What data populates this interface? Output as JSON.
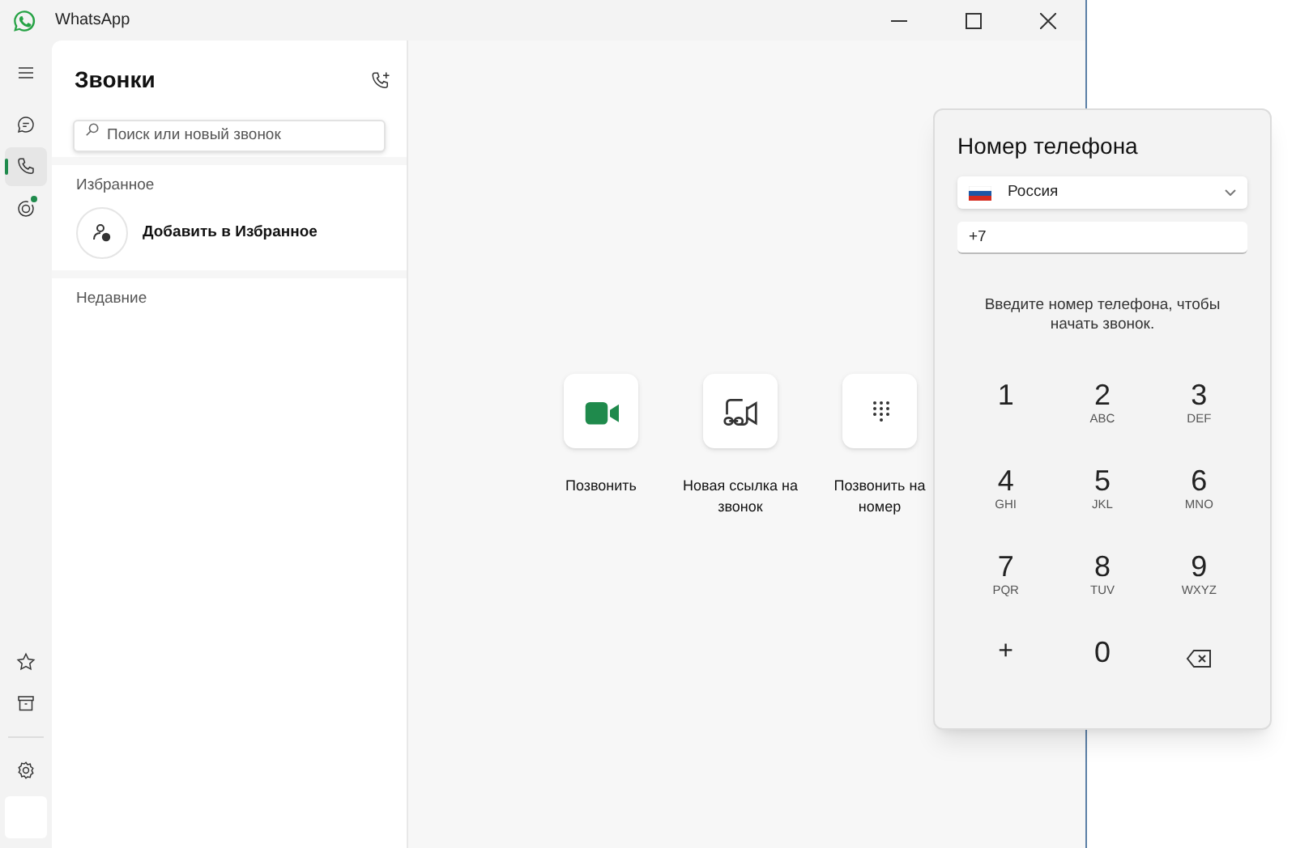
{
  "window": {
    "title": "WhatsApp"
  },
  "nav": {
    "top": [
      {
        "kind": "menu",
        "selected": false,
        "badge": false
      },
      {
        "kind": "chats",
        "selected": false,
        "badge": false
      },
      {
        "kind": "calls",
        "selected": true,
        "badge": false
      },
      {
        "kind": "status",
        "selected": false,
        "badge": true
      }
    ],
    "bottom": [
      {
        "kind": "starred",
        "selected": false,
        "badge": false
      },
      {
        "kind": "archive",
        "selected": false,
        "badge": false
      },
      {
        "kind": "settings",
        "selected": false,
        "badge": false
      }
    ]
  },
  "calls_panel": {
    "title": "Звонки",
    "search": {
      "placeholder": "Поиск или новый звонок"
    },
    "favorites": {
      "heading": "Избранное",
      "add_label": "Добавить в Избранное"
    },
    "recent": {
      "heading": "Недавние"
    }
  },
  "actions": [
    {
      "kind": "video",
      "label": "Позвонить"
    },
    {
      "kind": "link",
      "label": "Новая ссылка на звонок"
    },
    {
      "kind": "dialpad",
      "label": "Позвонить на номер"
    }
  ],
  "dialer": {
    "title": "Номер телефона",
    "country": "Россия",
    "number": "+7",
    "hint": "Введите номер телефона, чтобы начать звонок.",
    "keys": [
      {
        "kind": "digit",
        "digit": "1"
      },
      {
        "kind": "digit",
        "digit": "2",
        "letters": "ABC"
      },
      {
        "kind": "digit",
        "digit": "3",
        "letters": "DEF"
      },
      {
        "kind": "digit",
        "digit": "4",
        "letters": "GHI"
      },
      {
        "kind": "digit",
        "digit": "5",
        "letters": "JKL"
      },
      {
        "kind": "digit",
        "digit": "6",
        "letters": "MNO"
      },
      {
        "kind": "digit",
        "digit": "7",
        "letters": "PQR"
      },
      {
        "kind": "digit",
        "digit": "8",
        "letters": "TUV"
      },
      {
        "kind": "digit",
        "digit": "9",
        "letters": "WXYZ"
      },
      {
        "kind": "symbol",
        "digit": "+"
      },
      {
        "kind": "digit",
        "digit": "0"
      },
      {
        "kind": "backspace"
      }
    ]
  }
}
